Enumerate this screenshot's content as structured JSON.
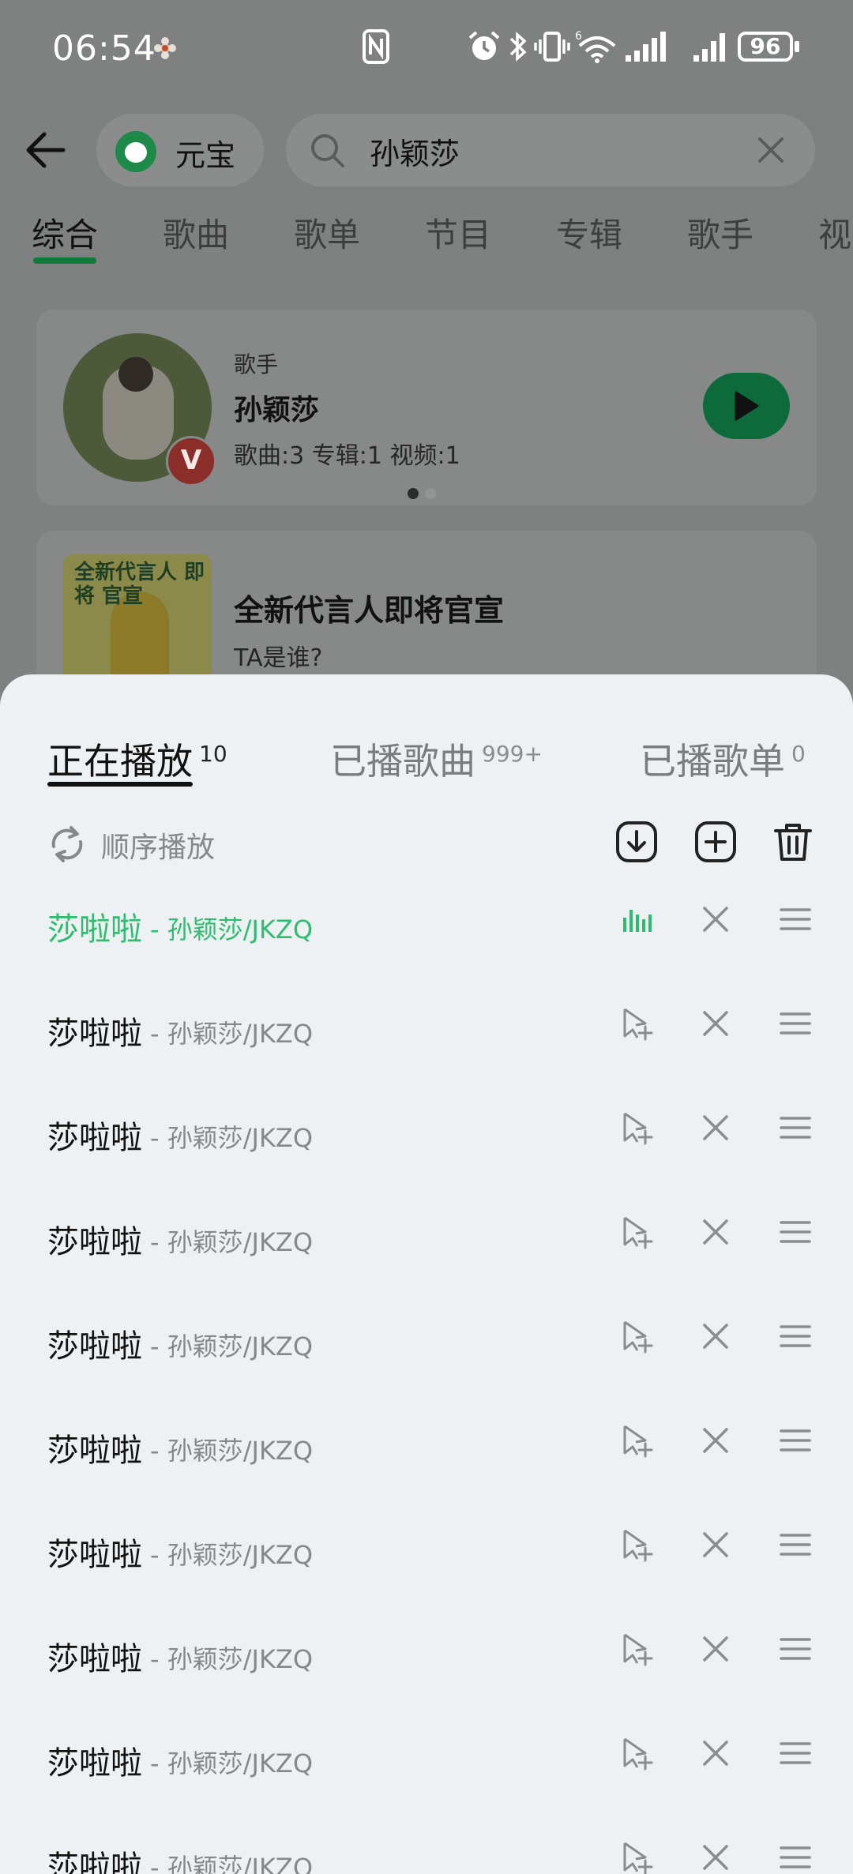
{
  "status_bar": {
    "time": "06:54",
    "battery": "96"
  },
  "search_bar": {
    "assistant_label": "元宝",
    "query": "孙颖莎"
  },
  "category_tabs": [
    {
      "label": "综合",
      "active": true
    },
    {
      "label": "歌曲",
      "active": false
    },
    {
      "label": "歌单",
      "active": false
    },
    {
      "label": "节目",
      "active": false
    },
    {
      "label": "专辑",
      "active": false
    },
    {
      "label": "歌手",
      "active": false
    },
    {
      "label": "视",
      "active": false
    }
  ],
  "singer_card": {
    "type_label": "歌手",
    "name": "孙颖莎",
    "stats": "歌曲:3 专辑:1 视频:1",
    "badge": "V"
  },
  "ad_card": {
    "image_text": "全新代言人 即将 官宣",
    "title": "全新代言人即将官宣",
    "subtitle": "TA是谁?"
  },
  "playlist_sheet": {
    "tabs": [
      {
        "label": "正在播放",
        "count": "10",
        "active": true
      },
      {
        "label": "已播歌曲",
        "count": "999+",
        "active": false
      },
      {
        "label": "已播歌单",
        "count": "0",
        "active": false
      }
    ],
    "play_mode": "顺序播放",
    "songs": [
      {
        "title": "莎啦啦",
        "artist": " - 孙颖莎/JKZQ",
        "playing": true
      },
      {
        "title": "莎啦啦",
        "artist": " - 孙颖莎/JKZQ",
        "playing": false
      },
      {
        "title": "莎啦啦",
        "artist": " - 孙颖莎/JKZQ",
        "playing": false
      },
      {
        "title": "莎啦啦",
        "artist": " - 孙颖莎/JKZQ",
        "playing": false
      },
      {
        "title": "莎啦啦",
        "artist": " - 孙颖莎/JKZQ",
        "playing": false
      },
      {
        "title": "莎啦啦",
        "artist": " - 孙颖莎/JKZQ",
        "playing": false
      },
      {
        "title": "莎啦啦",
        "artist": " - 孙颖莎/JKZQ",
        "playing": false
      },
      {
        "title": "莎啦啦",
        "artist": " - 孙颖莎/JKZQ",
        "playing": false
      },
      {
        "title": "莎啦啦",
        "artist": " - 孙颖莎/JKZQ",
        "playing": false
      },
      {
        "title": "莎啦啦",
        "artist": " - 孙颖莎/JKZQ",
        "playing": false
      }
    ]
  },
  "colors": {
    "accent_green": "#2ebd6e",
    "sheet_background": "#eef1f3",
    "dim_overlay": "#7f8080"
  },
  "icons": {
    "status": [
      "nfc-icon",
      "alarm-icon",
      "bluetooth-icon",
      "vibrate-icon",
      "wifi-icon",
      "signal-icon"
    ],
    "controls": [
      "download-icon",
      "add-to-playlist-icon",
      "delete-icon"
    ],
    "row": [
      "equalizer-icon",
      "insert-next-icon",
      "remove-icon",
      "drag-handle-icon"
    ]
  }
}
